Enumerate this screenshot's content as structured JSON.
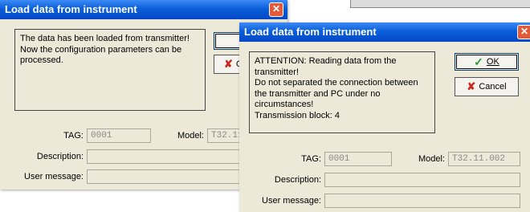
{
  "back_window": {
    "title": "Load data from instrument",
    "close_glyph": "✕",
    "message": "The data has been loaded from transmitter!\nNow the configuration parameters can be\nprocessed.",
    "ok_visible_glyph": "✓",
    "cancel_visible_text": "C",
    "tag_label": "TAG:",
    "tag_value": "0001",
    "model_label": "Model:",
    "model_value": "T32.11",
    "description_label": "Description:",
    "description_value": "",
    "user_message_label": "User message:",
    "user_message_value": ""
  },
  "front_window": {
    "title": "Load data from instrument",
    "close_glyph": "✕",
    "message": "ATTENTION: Reading data from the\ntransmitter!\nDo not separated the connection between\nthe transmitter and PC under no\ncircumstances!\nTransmission block: 4",
    "ok_label": "OK",
    "cancel_label": "Cancel",
    "tag_label": "TAG:",
    "tag_value": "0001",
    "model_label": "Model:",
    "model_value": "T32.11.002",
    "description_label": "Description:",
    "description_value": "",
    "user_message_label": "User message:",
    "user_message_value": ""
  },
  "icons": {
    "check": "✓",
    "cross": "✘"
  },
  "colors": {
    "titlebar": "#0a5fd8",
    "window_bg": "#ece9d8",
    "close_button": "#e25a3a"
  }
}
